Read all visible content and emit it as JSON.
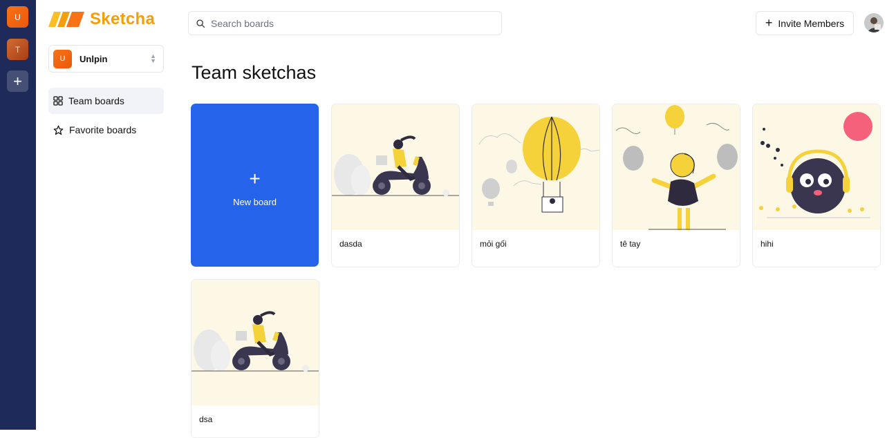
{
  "org_rail": {
    "orgs": [
      {
        "initial": "U",
        "color": "#f97316"
      },
      {
        "initial": "T",
        "color": "#ea580c"
      }
    ],
    "add_label": "+"
  },
  "sidebar": {
    "logo_text": "Sketcha",
    "org_name": "Unlpin",
    "org_initial": "U",
    "nav": [
      {
        "label": "Team boards",
        "icon": "grid-icon",
        "active": true
      },
      {
        "label": "Favorite boards",
        "icon": "star-icon",
        "active": false
      }
    ]
  },
  "header": {
    "search_placeholder": "Search boards",
    "invite_label": "Invite Members"
  },
  "main": {
    "title": "Team sketchas",
    "new_board_label": "New board",
    "boards": [
      {
        "title": "dasda",
        "image": "scooter-illustration"
      },
      {
        "title": "mỏi gối",
        "image": "balloon-illustration"
      },
      {
        "title": "tê tay",
        "image": "person-balloons-illustration"
      },
      {
        "title": "hihi",
        "image": "bird-headphones-illustration"
      },
      {
        "title": "dsa",
        "image": "scooter-illustration"
      }
    ]
  },
  "colors": {
    "rail": "#1e2a5a",
    "accent": "#2563eb",
    "brand": "#f59e0b",
    "thumb_bg": "#fdf8e6"
  }
}
